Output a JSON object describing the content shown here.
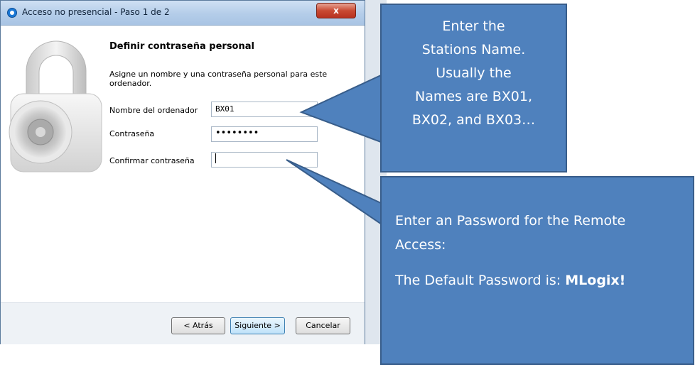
{
  "window": {
    "title": "Acceso no presencial - Paso 1 de 2",
    "close_label": "x"
  },
  "page": {
    "heading": "Definir contraseña personal",
    "description": "Asigne un nombre y una contraseña personal para este ordenador."
  },
  "form": {
    "computer_name_label": "Nombre del ordenador",
    "computer_name_value": "BX01",
    "password_label": "Contraseña",
    "password_value": "••••••••",
    "confirm_label": "Confirmar contraseña",
    "confirm_value": ""
  },
  "buttons": {
    "back": "< Atrás",
    "next": "Siguiente >",
    "cancel": "Cancelar"
  },
  "callouts": {
    "station": {
      "lines": [
        "Enter the",
        "Stations Name.",
        "Usually the",
        "Names are BX01,",
        "BX02, and BX03…"
      ]
    },
    "password": {
      "line1": "Enter an Password for the Remote Access:",
      "line2_prefix": "The Default Password is: ",
      "line2_bold": "MLogix!"
    }
  },
  "colors": {
    "callout_fill": "#4f81bd",
    "callout_border": "#385d8a"
  }
}
